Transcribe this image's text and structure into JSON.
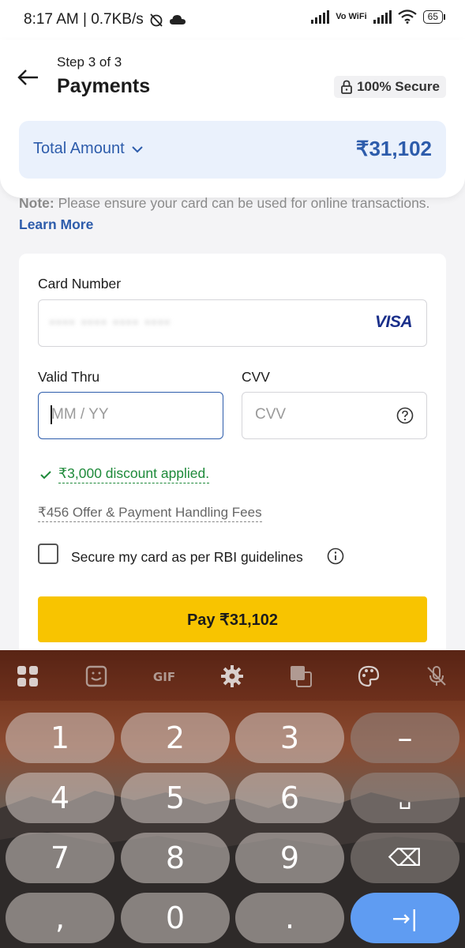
{
  "status_bar": {
    "time": "8:17 AM | 0.7KB/s",
    "vowifi": "Vo WiFi",
    "battery": "65"
  },
  "header": {
    "step": "Step 3 of 3",
    "title": "Payments",
    "secure_badge": "100% Secure",
    "total_label": "Total Amount",
    "total_value": "₹31,102"
  },
  "note": {
    "prefix": "Note:",
    "text": " Please ensure your card can be used for online transactions. ",
    "link": "Learn More"
  },
  "form": {
    "card_number_label": "Card Number",
    "card_number_value": "•••• •••• •••• ••••",
    "card_brand": "VISA",
    "valid_thru_label": "Valid Thru",
    "valid_thru_placeholder": "MM / YY",
    "cvv_label": "CVV",
    "cvv_placeholder": "CVV",
    "discount_text": "₹3,000 discount applied.",
    "fees_text": "₹456 Offer & Payment Handling Fees",
    "save_card_text": "Secure my card as per RBI guidelines",
    "pay_button": "Pay ₹31,102"
  },
  "keyboard": {
    "toolbar": [
      "apps-icon",
      "sticker-icon",
      "gif-icon",
      "settings-icon",
      "translate-icon",
      "theme-icon",
      "mic-off-icon"
    ],
    "gif_label": "GIF",
    "keys": [
      {
        "label": "1"
      },
      {
        "label": "2"
      },
      {
        "label": "3"
      },
      {
        "label": "–"
      },
      {
        "label": "4"
      },
      {
        "label": "5"
      },
      {
        "label": "6"
      },
      {
        "label": "␣"
      },
      {
        "label": "7"
      },
      {
        "label": "8"
      },
      {
        "label": "9"
      },
      {
        "label": "⌫"
      },
      {
        "label": ","
      },
      {
        "label": "0"
      },
      {
        "label": "."
      },
      {
        "label": "→|"
      }
    ]
  },
  "colors": {
    "accent": "#2d5cab",
    "pay_button": "#f8c400",
    "success": "#1e8a3a",
    "enter_key": "#5f9cf2"
  }
}
